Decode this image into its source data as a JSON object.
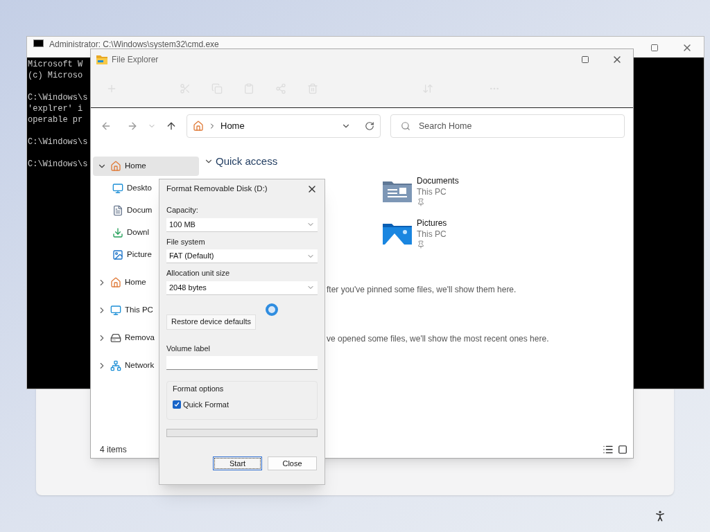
{
  "cmd": {
    "title": "Administrator: C:\\Windows\\system32\\cmd.exe",
    "blocks": [
      [
        "Microsoft W",
        "(c) Microso"
      ],
      [
        "C:\\Windows\\s",
        "'explrer' i",
        "operable pr"
      ],
      [
        "C:\\Windows\\s"
      ],
      [
        "C:\\Windows\\s"
      ]
    ]
  },
  "explorer": {
    "title": "File Explorer",
    "address": {
      "path": "Home"
    },
    "search": {
      "placeholder": "Search Home"
    },
    "sidebar": [
      {
        "label": "Home",
        "kind": "home",
        "expanded": true,
        "selected": true,
        "children": [
          {
            "label": "Deskto",
            "kind": "desktop",
            "selected": false
          },
          {
            "label": "Docum",
            "kind": "documents",
            "selected": false
          },
          {
            "label": "Downl",
            "kind": "downloads",
            "selected": false
          },
          {
            "label": "Picture",
            "kind": "pictures",
            "selected": false
          }
        ]
      },
      {
        "label": "Home",
        "kind": "home",
        "expanded": false,
        "selected": false
      },
      {
        "label": "This PC",
        "kind": "pc",
        "expanded": false,
        "selected": false
      },
      {
        "label": "Remova",
        "kind": "drive",
        "expanded": false,
        "selected": false
      },
      {
        "label": "Network",
        "kind": "network",
        "expanded": false,
        "selected": false
      }
    ],
    "quick_access": {
      "title": "Quick access",
      "expanded": true,
      "items": [
        {
          "name": "Documents",
          "location": "This PC",
          "kind": "documents",
          "pinned": true
        },
        {
          "name": "Pictures",
          "location": "This PC",
          "kind": "pictures",
          "pinned": true
        }
      ]
    },
    "messages": [
      "fter you've pinned some files, we'll show them here.",
      "ve opened some files, we'll show the most recent ones here."
    ],
    "status": "4 items"
  },
  "dialog": {
    "title": "Format Removable Disk (D:)",
    "fields": [
      {
        "label": "Capacity:",
        "value": "100 MB"
      },
      {
        "label": "File system",
        "value": "FAT (Default)"
      },
      {
        "label": "Allocation unit size",
        "value": "2048 bytes"
      }
    ],
    "restore_button": "Restore device defaults",
    "busy": true,
    "volume_label": {
      "label": "Volume label"
    },
    "format_options": {
      "title": "Format options",
      "quick_format": {
        "label": "Quick Format",
        "checked": true
      }
    },
    "progress": {
      "level": 0
    },
    "buttons": [
      {
        "label": "Start",
        "default": true
      },
      {
        "label": "Close",
        "default": false
      }
    ]
  }
}
